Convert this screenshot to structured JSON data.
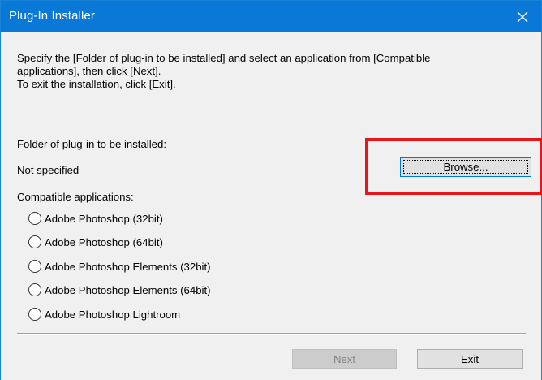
{
  "window": {
    "title": "Plug-In Installer"
  },
  "instructions": {
    "line1": "Specify the [Folder of plug-in to be installed] and select an application from [Compatible",
    "line2": "applications], then click [Next].",
    "line3": "To exit the installation, click [Exit]."
  },
  "folder": {
    "label": "Folder of plug-in to be installed:",
    "value": "Not specified",
    "browse_label": "Browse..."
  },
  "applications": {
    "label": "Compatible applications:",
    "items": [
      {
        "label": "Adobe Photoshop (32bit)",
        "selected": false
      },
      {
        "label": "Adobe Photoshop (64bit)",
        "selected": false
      },
      {
        "label": "Adobe Photoshop Elements (32bit)",
        "selected": false
      },
      {
        "label": "Adobe Photoshop Elements (64bit)",
        "selected": false
      },
      {
        "label": "Adobe Photoshop Lightroom",
        "selected": false
      }
    ]
  },
  "footer": {
    "next_label": "Next",
    "next_enabled": false,
    "exit_label": "Exit"
  },
  "colors": {
    "titlebar": "#0a78d7",
    "dialog_bg": "#f0f0f0",
    "highlight": "#e8161b"
  },
  "icons": {
    "close": "close-icon",
    "radio": "radio-button"
  }
}
